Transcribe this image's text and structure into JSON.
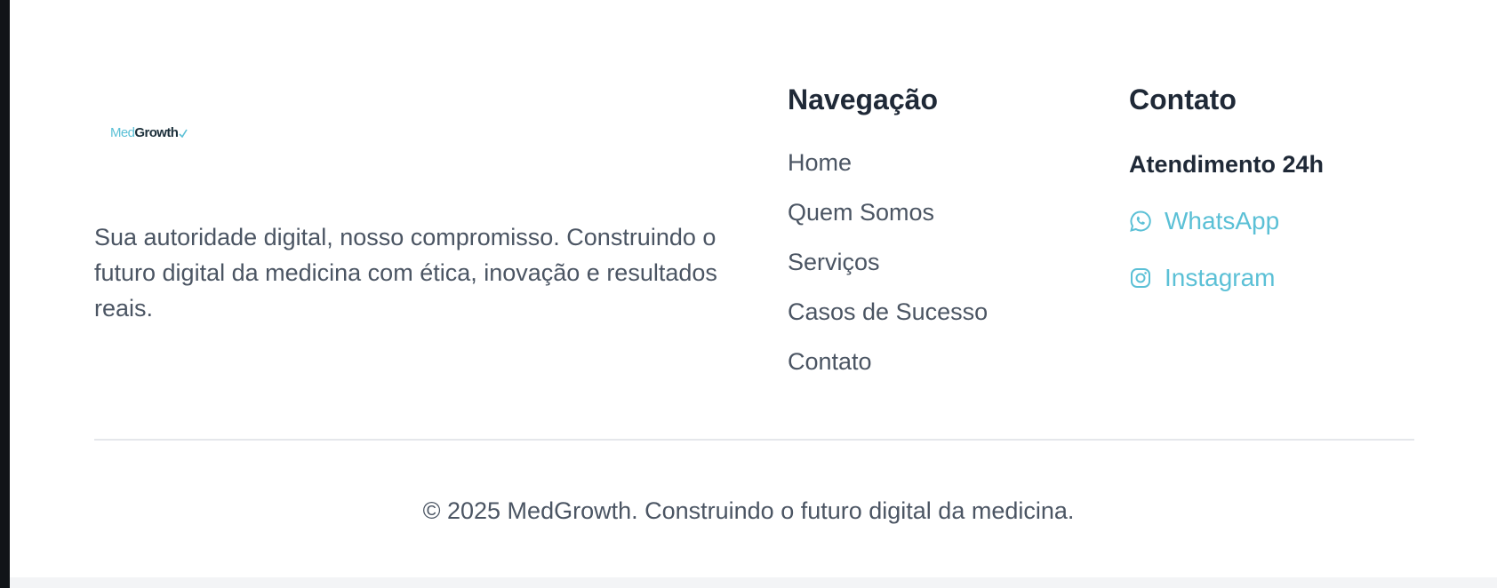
{
  "brand": {
    "logo_med": "Med",
    "logo_growth": "Growth",
    "tagline": "Sua autoridade digital, nosso compromisso. Construindo o futuro digital da medicina com ética, inovação e resultados reais."
  },
  "navigation": {
    "title": "Navegação",
    "items": [
      {
        "label": "Home"
      },
      {
        "label": "Quem Somos"
      },
      {
        "label": "Serviços"
      },
      {
        "label": "Casos de Sucesso"
      },
      {
        "label": "Contato"
      }
    ]
  },
  "contact": {
    "title": "Contato",
    "hours": "Atendimento 24h",
    "links": [
      {
        "label": "WhatsApp",
        "icon": "whatsapp-icon"
      },
      {
        "label": "Instagram",
        "icon": "instagram-icon"
      }
    ]
  },
  "footer": {
    "copyright": "© 2025 MedGrowth. Construindo o futuro digital da medicina."
  },
  "colors": {
    "accent": "#5bc0d6",
    "heading": "#1f2937",
    "body_text": "#4b5563",
    "divider": "#e5e7eb"
  }
}
